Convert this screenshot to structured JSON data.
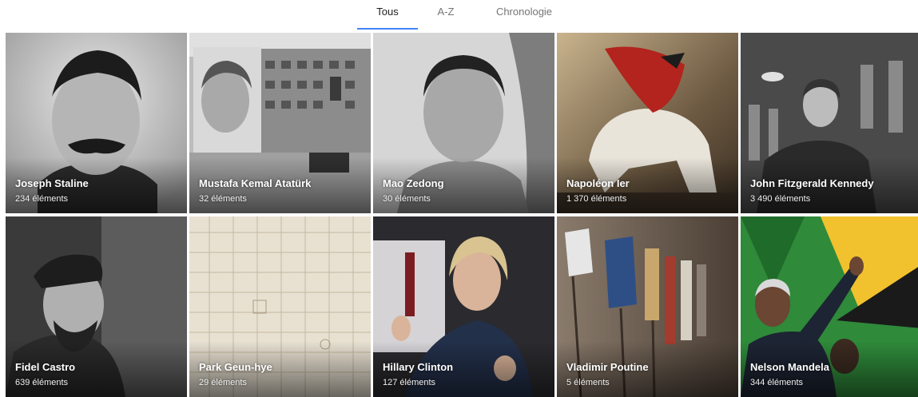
{
  "tabs": [
    {
      "label": "Tous",
      "active": true
    },
    {
      "label": "A-Z",
      "active": false
    },
    {
      "label": "Chronologie",
      "active": false
    }
  ],
  "accent_color": "#4285f4",
  "tiles": [
    {
      "name": "Joseph Staline",
      "count": "234 éléments"
    },
    {
      "name": "Mustafa Kemal Atatürk",
      "count": "32 éléments"
    },
    {
      "name": "Mao Zedong",
      "count": "30 éléments"
    },
    {
      "name": "Napoléon Ier",
      "count": "1 370 éléments"
    },
    {
      "name": "John Fitzgerald Kennedy",
      "count": "3 490 éléments"
    },
    {
      "name": "Fidel Castro",
      "count": "639 éléments"
    },
    {
      "name": "Park Geun-hye",
      "count": "29 éléments"
    },
    {
      "name": "Hillary Clinton",
      "count": "127 éléments"
    },
    {
      "name": "Vladimir Poutine",
      "count": "5 éléments"
    },
    {
      "name": "Nelson Mandela",
      "count": "344 éléments"
    }
  ]
}
